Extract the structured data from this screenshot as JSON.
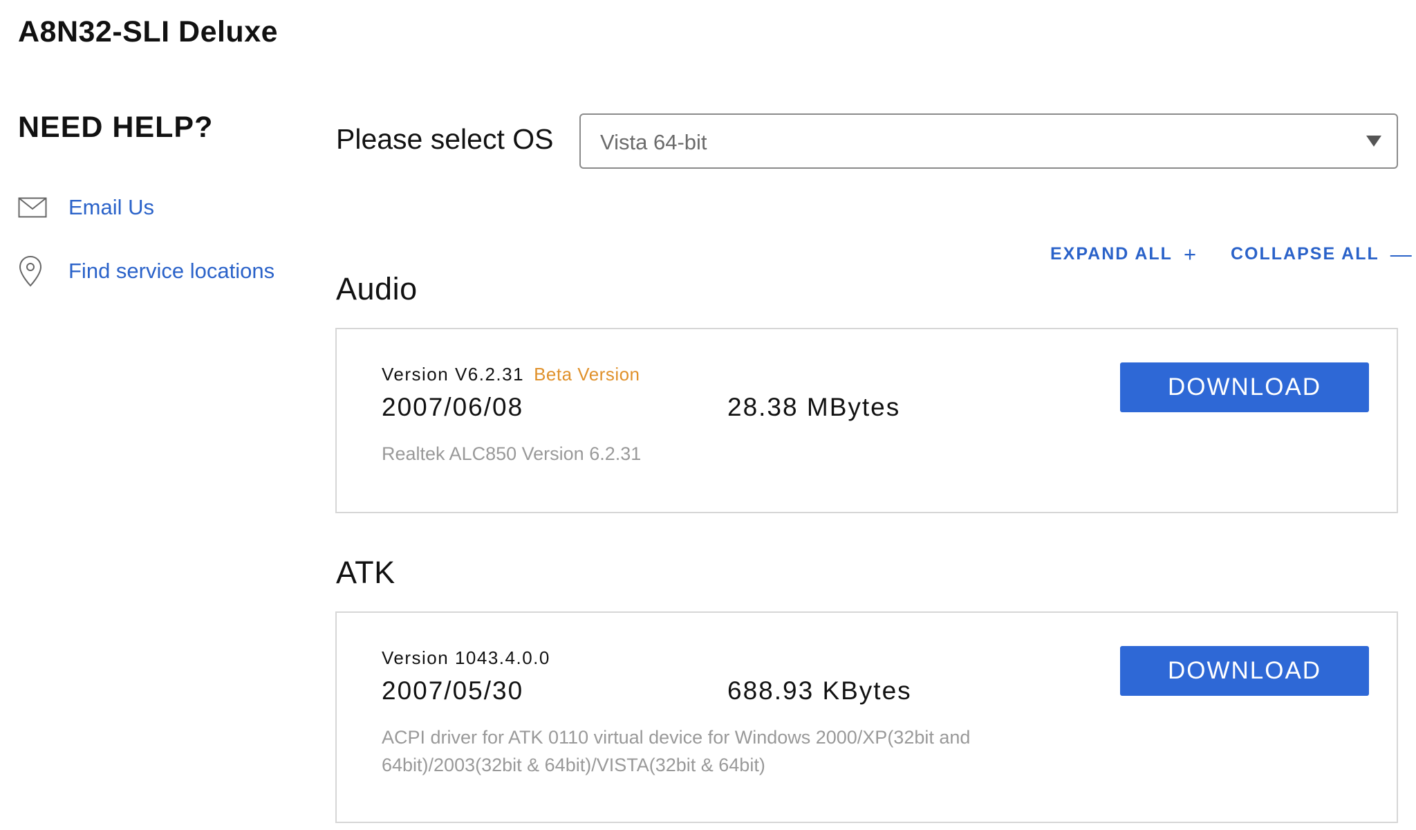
{
  "product": {
    "title": "A8N32-SLI Deluxe"
  },
  "sidebar": {
    "heading": "NEED HELP?",
    "links": [
      {
        "label": "Email Us",
        "icon": "mail-icon"
      },
      {
        "label": "Find service locations",
        "icon": "location-pin-icon"
      }
    ]
  },
  "os_select": {
    "label": "Please select OS",
    "value": "Vista 64-bit",
    "icon": "caret-down-icon"
  },
  "controls": {
    "expand_all": "EXPAND ALL",
    "expand_icon": "+",
    "collapse_all": "COLLAPSE ALL",
    "collapse_icon": "—"
  },
  "sections": [
    {
      "title": "Audio",
      "items": [
        {
          "version": "Version V6.2.31",
          "badge": "Beta Version",
          "date": "2007/06/08",
          "size": "28.38 MBytes",
          "description": "Realtek ALC850 Version 6.2.31",
          "button": "DOWNLOAD"
        }
      ]
    },
    {
      "title": "ATK",
      "items": [
        {
          "version": "Version 1043.4.0.0",
          "date": "2007/05/30",
          "size": "688.93 KBytes",
          "description": "ACPI driver for ATK 0110 virtual device for Windows 2000/XP(32bit and 64bit)/2003(32bit & 64bit)/VISTA(32bit & 64bit)",
          "button": "DOWNLOAD"
        }
      ]
    }
  ],
  "colors": {
    "link": "#2a62c9",
    "button": "#2e68d6",
    "beta": "#e0912b",
    "muted_text": "#999999",
    "card_border": "#d6d6d6"
  }
}
